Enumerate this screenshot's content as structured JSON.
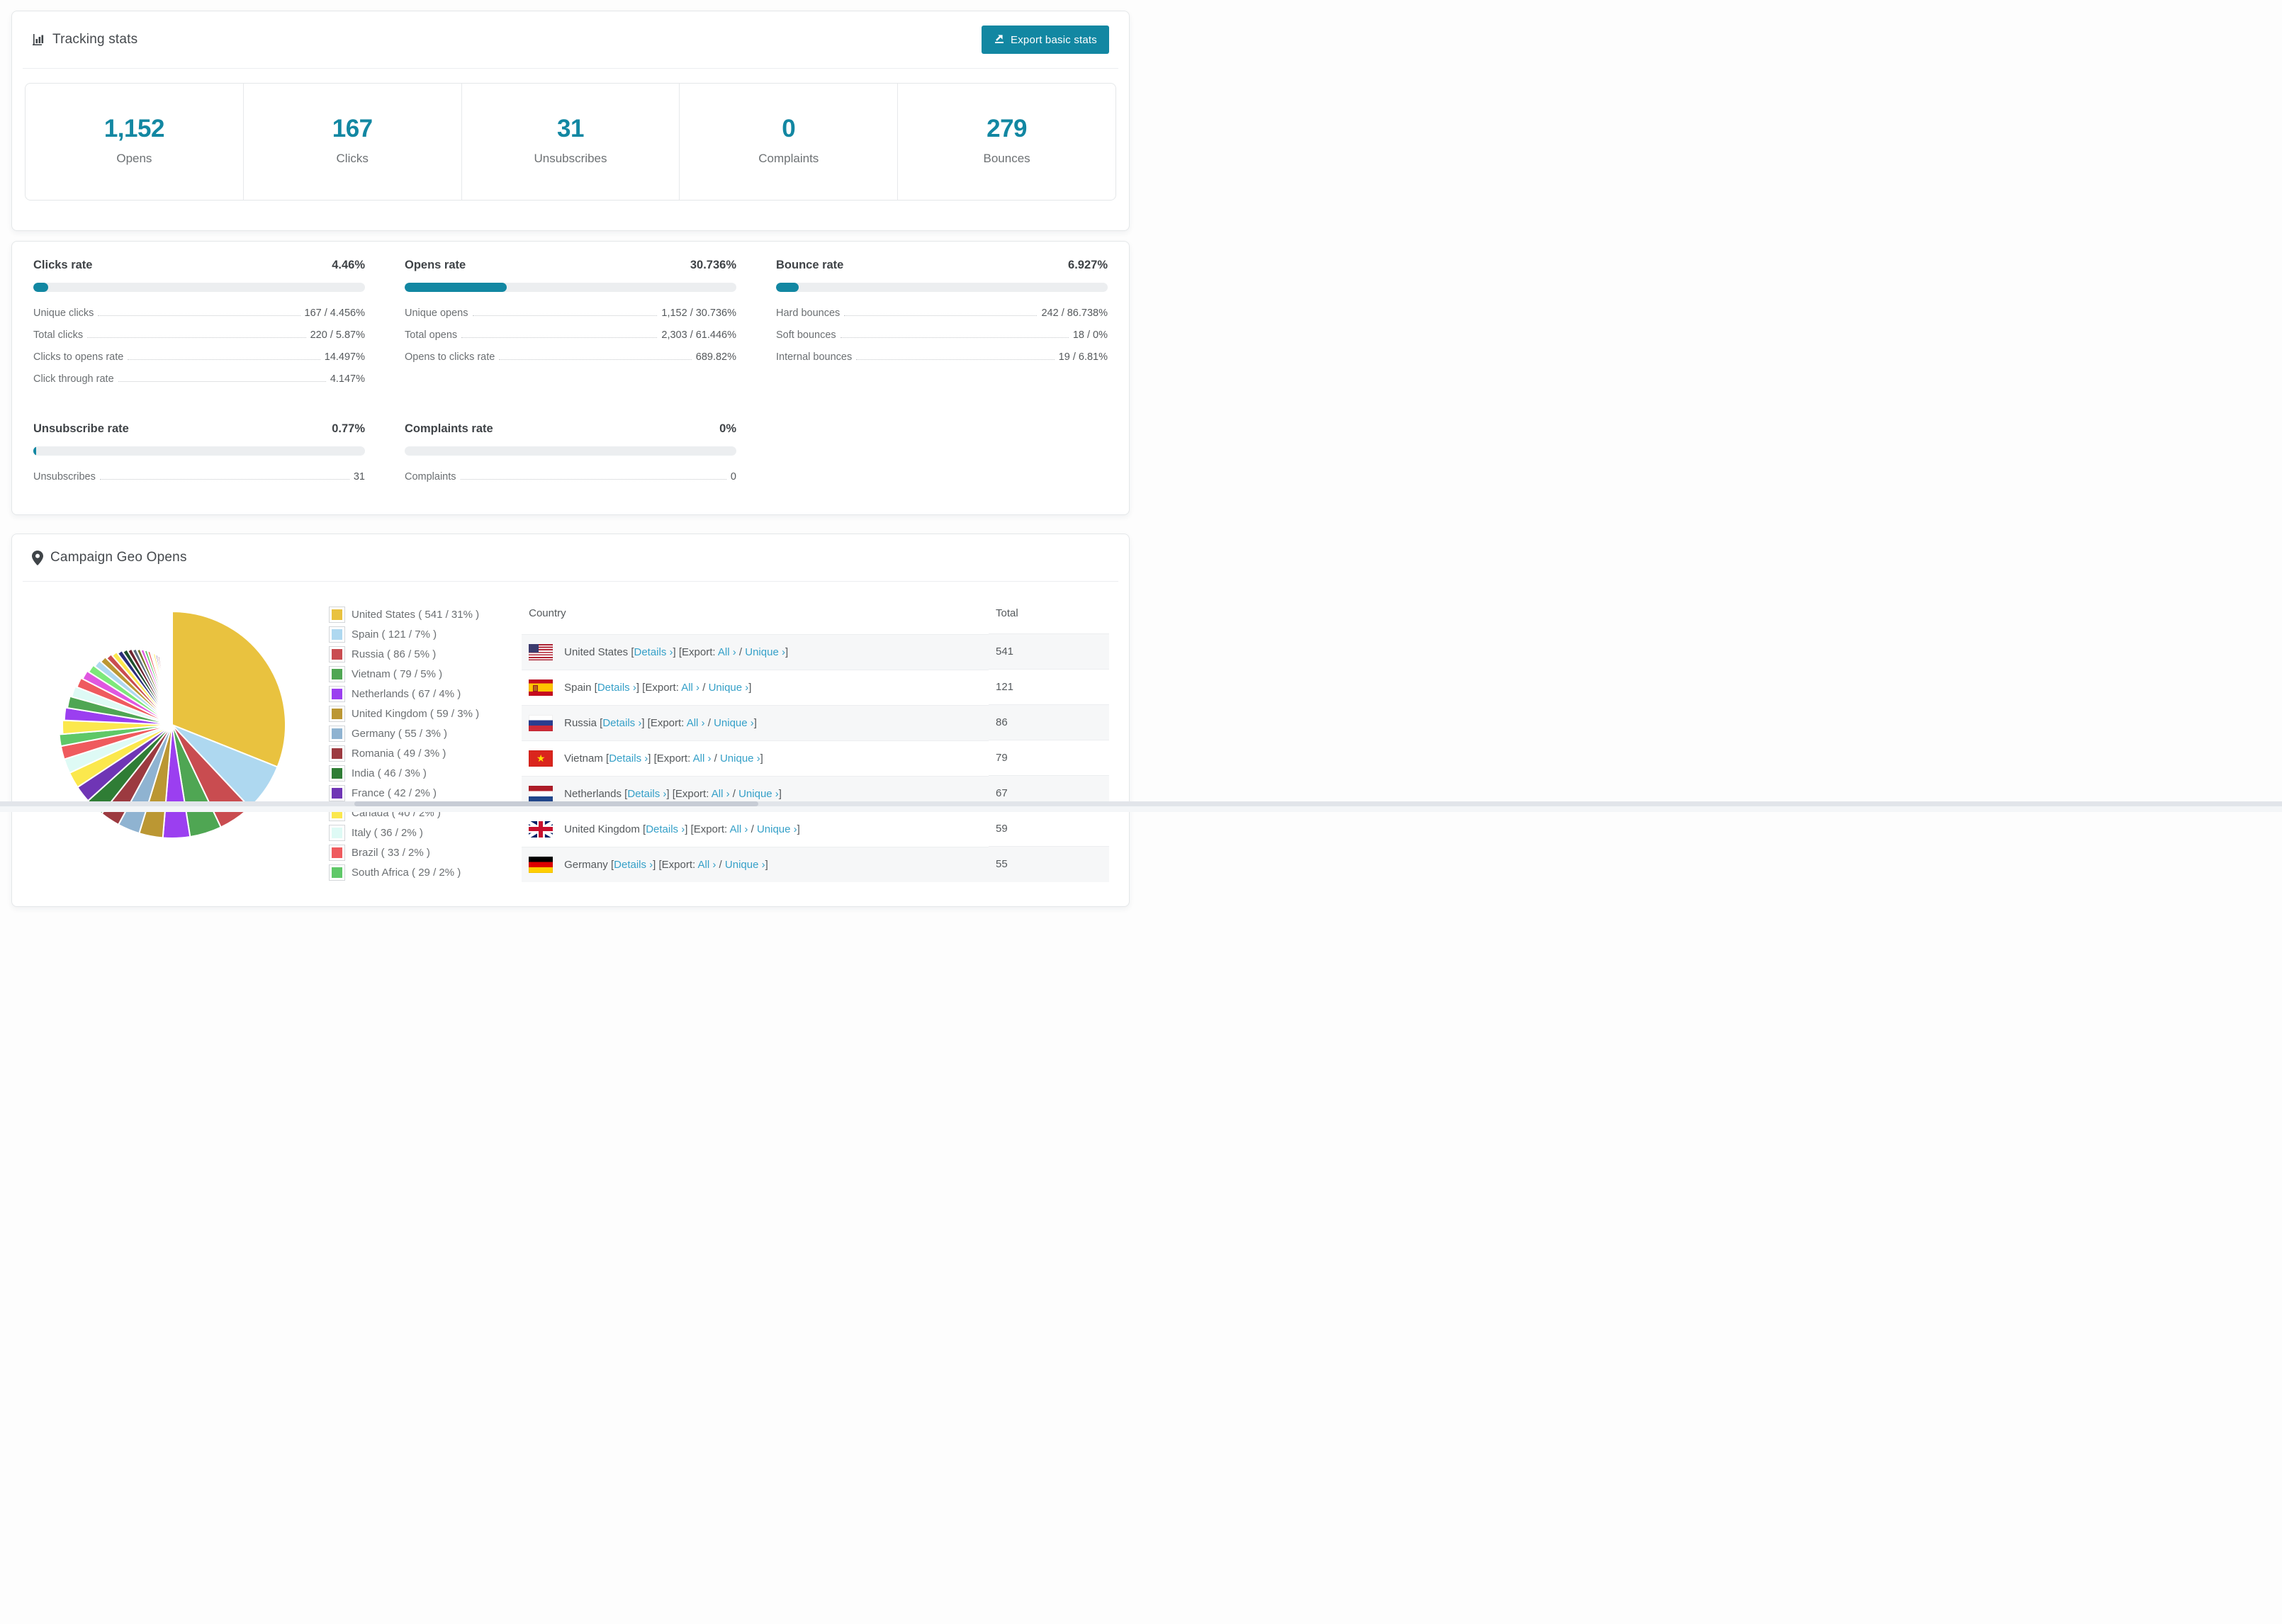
{
  "accent": "#1287a2",
  "link_color": "#35a0c8",
  "tracking": {
    "title": "Tracking stats",
    "export_label": "Export basic stats",
    "summary": [
      {
        "value": "1,152",
        "label": "Opens"
      },
      {
        "value": "167",
        "label": "Clicks"
      },
      {
        "value": "31",
        "label": "Unsubscribes"
      },
      {
        "value": "0",
        "label": "Complaints"
      },
      {
        "value": "279",
        "label": "Bounces"
      }
    ]
  },
  "rates": {
    "clicks": {
      "title": "Clicks rate",
      "value": "4.46%",
      "percent": 4.46,
      "rows": [
        {
          "label": "Unique clicks",
          "value": "167 / 4.456%"
        },
        {
          "label": "Total clicks",
          "value": "220 / 5.87%"
        },
        {
          "label": "Clicks to opens rate",
          "value": "14.497%"
        },
        {
          "label": "Click through rate",
          "value": "4.147%"
        }
      ]
    },
    "opens": {
      "title": "Opens rate",
      "value": "30.736%",
      "percent": 30.736,
      "rows": [
        {
          "label": "Unique opens",
          "value": "1,152 / 30.736%"
        },
        {
          "label": "Total opens",
          "value": "2,303 / 61.446%"
        },
        {
          "label": "Opens to clicks rate",
          "value": "689.82%"
        }
      ]
    },
    "bounce": {
      "title": "Bounce rate",
      "value": "6.927%",
      "percent": 6.927,
      "rows": [
        {
          "label": "Hard bounces",
          "value": "242 / 86.738%"
        },
        {
          "label": "Soft bounces",
          "value": "18 / 0%"
        },
        {
          "label": "Internal bounces",
          "value": "19 / 6.81%"
        }
      ]
    },
    "unsubscribe": {
      "title": "Unsubscribe rate",
      "value": "0.77%",
      "percent": 0.77,
      "rows": [
        {
          "label": "Unsubscribes",
          "value": "31"
        }
      ]
    },
    "complaints": {
      "title": "Complaints rate",
      "value": "0%",
      "percent": 0,
      "rows": [
        {
          "label": "Complaints",
          "value": "0"
        }
      ]
    }
  },
  "geo": {
    "title": "Campaign Geo Opens",
    "link_labels": {
      "details": "Details ›",
      "export_prefix": "Export:",
      "all": "All ›",
      "unique": "Unique ›"
    },
    "table": {
      "columns": [
        "Country",
        "Total"
      ],
      "rows": [
        {
          "country": "United States",
          "flag": "us",
          "total": "541"
        },
        {
          "country": "Spain",
          "flag": "es",
          "total": "121"
        },
        {
          "country": "Russia",
          "flag": "ru",
          "total": "86"
        },
        {
          "country": "Vietnam",
          "flag": "vn",
          "total": "79"
        },
        {
          "country": "Netherlands",
          "flag": "nl",
          "total": "67"
        },
        {
          "country": "United Kingdom",
          "flag": "gb",
          "total": "59"
        },
        {
          "country": "Germany",
          "flag": "de",
          "total": "55"
        }
      ]
    }
  },
  "chart_data": {
    "type": "pie",
    "title": "Campaign Geo Opens",
    "legend_position": "right",
    "series": [
      {
        "name": "United States",
        "count": 541,
        "pct": 31,
        "color": "#e9c23f"
      },
      {
        "name": "Spain",
        "count": 121,
        "pct": 7,
        "color": "#aed8f0"
      },
      {
        "name": "Russia",
        "count": 86,
        "pct": 5,
        "color": "#c94c50"
      },
      {
        "name": "Vietnam",
        "count": 79,
        "pct": 5,
        "color": "#4fa653"
      },
      {
        "name": "Netherlands",
        "count": 67,
        "pct": 4,
        "color": "#9b3ff0"
      },
      {
        "name": "United Kingdom",
        "count": 59,
        "pct": 3,
        "color": "#bb9733"
      },
      {
        "name": "Germany",
        "count": 55,
        "pct": 3,
        "color": "#8fb3d1"
      },
      {
        "name": "Romania",
        "count": 49,
        "pct": 3,
        "color": "#9c3a40"
      },
      {
        "name": "India",
        "count": 46,
        "pct": 3,
        "color": "#2f7d35"
      },
      {
        "name": "France",
        "count": 42,
        "pct": 2,
        "color": "#6f35b5"
      },
      {
        "name": "Canada",
        "count": 40,
        "pct": 2,
        "color": "#fbe84d"
      },
      {
        "name": "Italy",
        "count": 36,
        "pct": 2,
        "color": "#defaf5"
      },
      {
        "name": "Brazil",
        "count": 33,
        "pct": 2,
        "color": "#ef5a5e"
      },
      {
        "name": "South Africa",
        "count": 29,
        "pct": 2,
        "color": "#5fc868"
      }
    ],
    "other_values": [
      35,
      33,
      31,
      29,
      27,
      25,
      23,
      21,
      19,
      18,
      17,
      16,
      15,
      14,
      13,
      12,
      11,
      10,
      9,
      8,
      8,
      7,
      7,
      6,
      6,
      5,
      5,
      4,
      4,
      3,
      3,
      3,
      2,
      2,
      2,
      2,
      1,
      1,
      1,
      1
    ],
    "other_palette": [
      "#fbe84d",
      "#9b3ff0",
      "#4fa653",
      "#defaf5",
      "#ef5a5e",
      "#e057e0",
      "#7de87a",
      "#aed8f0",
      "#bb9733",
      "#c94c50",
      "#fbe84d",
      "#2b2d7a",
      "#1e4f2c",
      "#6e2430",
      "#5b6f80",
      "#77772a",
      "#e057e0",
      "#5fc868",
      "#ef5a5e",
      "#f2fbff",
      "#fbe84d",
      "#4f2a8f",
      "#9c3a40",
      "#2f7d35",
      "#8fb3d1",
      "#e9c23f",
      "#c94c50",
      "#aed8f0",
      "#5fc868",
      "#e057e0",
      "#6f35b5",
      "#fbe84d",
      "#ef5a5e",
      "#2f7d35",
      "#9b3ff0",
      "#bb9733",
      "#c94c50",
      "#4fa653",
      "#aed8f0",
      "#e9c23f"
    ]
  }
}
